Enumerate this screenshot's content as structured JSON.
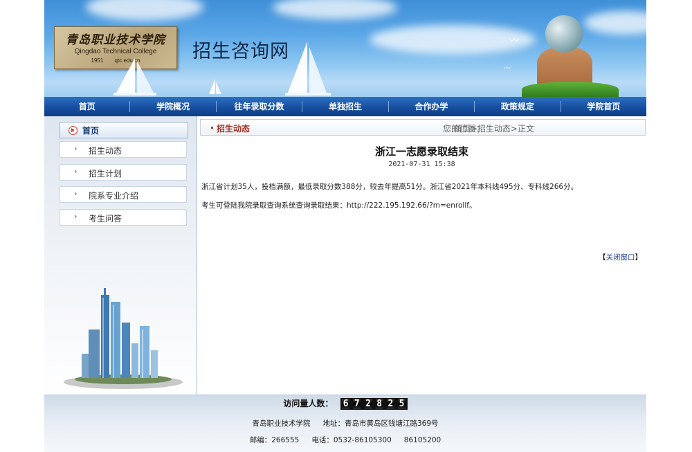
{
  "banner": {
    "logo": {
      "cn": "青岛职业技术学院",
      "en": "Qingdao Technical College",
      "year": "1951",
      "domain": "qtc.edu.cn"
    },
    "site_title": "招生咨询网"
  },
  "nav": {
    "items": [
      "首页",
      "学院概况",
      "往年录取分数",
      "单独招生",
      "合作办学",
      "政策规定",
      "学院首页"
    ]
  },
  "sidebar": {
    "home_label": "首页",
    "items": [
      {
        "label": "招生动态",
        "icon": "chevron-right-icon"
      },
      {
        "label": "招生计划",
        "icon": "chevron-right-icon"
      },
      {
        "label": "院系专业介绍",
        "icon": "chevron-right-icon"
      },
      {
        "label": "考生问答",
        "icon": "chevron-right-icon"
      }
    ]
  },
  "content": {
    "category": "招生动态",
    "position_label": "您的位置：",
    "breadcrumb": "首页>招生动态>正文",
    "title": "浙江一志愿录取结束",
    "datetime": "2021-07-31 15:38",
    "paragraph1": "浙江省计划35人，投档满额，最低录取分数388分，较去年提高51分。浙江省2021年本科线495分、专科线266分。",
    "paragraph2": "考生可登陆我院录取查询系统查询录取结果：http://222.195.192.66/?m=enrollf。",
    "close_open": "【",
    "close_label": "关闭窗口",
    "close_end": "】"
  },
  "footer": {
    "visit_label": "访问量人数：",
    "visit_digits": [
      "6",
      "7",
      "2",
      "8",
      "2",
      "5"
    ],
    "school": "青岛职业技术学院",
    "address": "地址：青岛市黄岛区钱塘江路369号",
    "postcode": "邮编：266555",
    "phone": "电话：0532-86105300",
    "phone2": "86105200"
  },
  "colors": {
    "nav_blue": "#164f9f",
    "category_red": "#a3301f",
    "link_blue": "#1a3d8f"
  }
}
